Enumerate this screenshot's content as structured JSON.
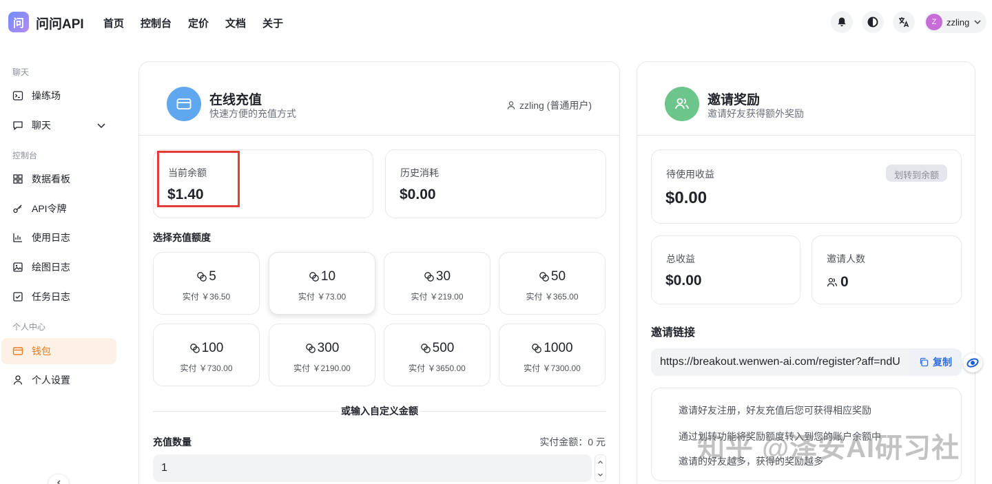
{
  "app": {
    "logo_text": "问",
    "brand": "问问API"
  },
  "nav": [
    "首页",
    "控制台",
    "定价",
    "文档",
    "关于"
  ],
  "user": {
    "avatar_letter": "Z",
    "name": "zzling"
  },
  "sidebar": {
    "sections": [
      {
        "title": "聊天"
      },
      {
        "title": "控制台"
      },
      {
        "title": "个人中心"
      }
    ],
    "items": [
      {
        "label": "操练场",
        "icon": "playground-icon"
      },
      {
        "label": "聊天",
        "icon": "chat-icon"
      },
      {
        "label": "数据看板",
        "icon": "dashboard-icon"
      },
      {
        "label": "API令牌",
        "icon": "key-icon"
      },
      {
        "label": "使用日志",
        "icon": "chart-icon"
      },
      {
        "label": "绘图日志",
        "icon": "image-icon"
      },
      {
        "label": "任务日志",
        "icon": "task-icon"
      },
      {
        "label": "钱包",
        "icon": "wallet-icon",
        "active": true
      },
      {
        "label": "个人设置",
        "icon": "user-icon"
      }
    ]
  },
  "recharge": {
    "title": "在线充值",
    "subtitle": "快速方便的充值方式",
    "user_tag": "zzling (普通用户)",
    "balance_label": "当前余额",
    "balance_value": "$1.40",
    "history_label": "历史消耗",
    "history_value": "$0.00",
    "select_label": "选择充值额度",
    "amounts": [
      {
        "value": "5",
        "pay": "实付 ￥36.50"
      },
      {
        "value": "10",
        "pay": "实付 ￥73.00"
      },
      {
        "value": "30",
        "pay": "实付 ￥219.00"
      },
      {
        "value": "50",
        "pay": "实付 ￥365.00"
      },
      {
        "value": "100",
        "pay": "实付 ￥730.00"
      },
      {
        "value": "300",
        "pay": "实付 ￥2190.00"
      },
      {
        "value": "500",
        "pay": "实付 ￥3650.00"
      },
      {
        "value": "1000",
        "pay": "实付 ￥7300.00"
      }
    ],
    "custom_label": "或输入自定义金额",
    "qty_label": "充值数量",
    "actual_pay": "实付金额：0 元",
    "qty_value": "1"
  },
  "invite": {
    "title": "邀请奖励",
    "subtitle": "邀请好友获得额外奖励",
    "pending_label": "待使用收益",
    "transfer_button": "划转到余额",
    "pending_value": "$0.00",
    "total_label": "总收益",
    "total_value": "$0.00",
    "count_label": "邀请人数",
    "count_value": "0",
    "link_label": "邀请链接",
    "link_value": "https://breakout.wenwen-ai.com/register?aff=ndU",
    "copy_button": "复制",
    "notes": [
      "邀请好友注册，好友充值后您可获得相应奖励",
      "通过划转功能将奖励额度转入到您的账户余额中",
      "邀请的好友越多，获得的奖励越多"
    ]
  },
  "watermark": "知乎 @泽安AI研习社",
  "colors": {
    "accent": "#f27a1a",
    "blue": "#5fa8f0",
    "green": "#6cc58a",
    "highlight": "#e63a3a"
  }
}
